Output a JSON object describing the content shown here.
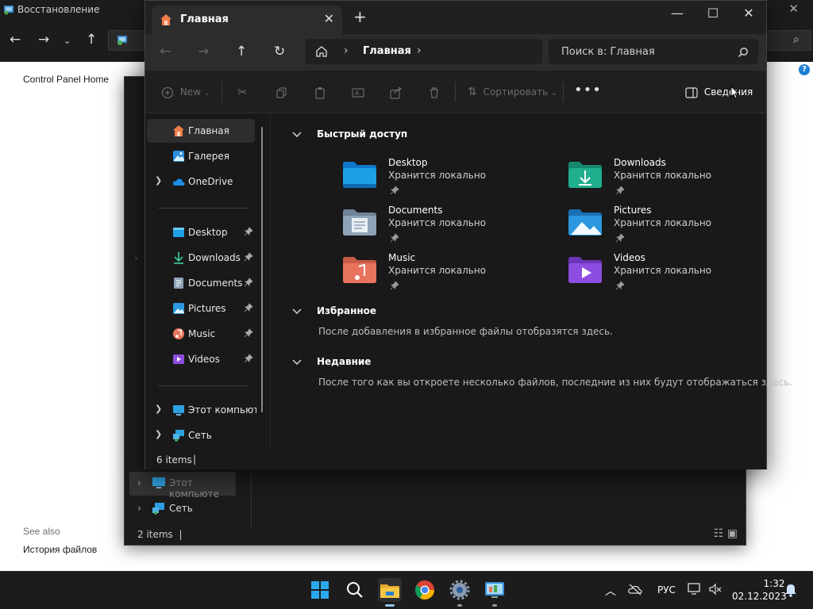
{
  "background_window": {
    "title": "Восстановление",
    "sidebar_link": "Control Panel Home",
    "see_also_label": "See also",
    "see_also_link": "История файлов"
  },
  "middle_window": {
    "items": [
      {
        "label": "Этот компьюте"
      },
      {
        "label": "Сеть"
      }
    ],
    "status": "2 items"
  },
  "explorer": {
    "tab_label": "Главная",
    "new_tab_symbol": "+",
    "address_label": "Главная",
    "search_placeholder": "Поиск в: Главная",
    "toolbar": {
      "new_label": "New",
      "sort_label": "Сортировать",
      "more_label": "•••",
      "details_label": "Сведения"
    },
    "sidebar": [
      {
        "label": "Главная",
        "icon": "home-icon"
      },
      {
        "label": "Галерея",
        "icon": "gallery-icon"
      },
      {
        "label": "OneDrive",
        "icon": "onedrive-icon"
      },
      {
        "label": "Desktop",
        "icon": "desktop-folder-icon"
      },
      {
        "label": "Downloads",
        "icon": "downloads-folder-icon"
      },
      {
        "label": "Documents",
        "icon": "documents-folder-icon"
      },
      {
        "label": "Pictures",
        "icon": "pictures-folder-icon"
      },
      {
        "label": "Music",
        "icon": "music-folder-icon"
      },
      {
        "label": "Videos",
        "icon": "videos-folder-icon"
      },
      {
        "label": "Этот компьюте",
        "icon": "this-pc-icon"
      },
      {
        "label": "Сеть",
        "icon": "network-icon"
      }
    ],
    "quick_access": {
      "heading": "Быстрый доступ",
      "items": [
        {
          "name": "Desktop",
          "status": "Хранится локально",
          "color": "#1ea0e6"
        },
        {
          "name": "Downloads",
          "status": "Хранится локально",
          "color": "#1fae8e"
        },
        {
          "name": "Documents",
          "status": "Хранится локально",
          "color": "#8fa3b8"
        },
        {
          "name": "Pictures",
          "status": "Хранится локально",
          "color": "#2b98e0"
        },
        {
          "name": "Music",
          "status": "Хранится локально",
          "color": "#e9745e"
        },
        {
          "name": "Videos",
          "status": "Хранится локально",
          "color": "#8c4de0"
        }
      ]
    },
    "favorites": {
      "heading": "Избранное",
      "message": "После добавления в избранное файлы отобразятся здесь."
    },
    "recent": {
      "heading": "Недавние",
      "message": "После того как вы откроете несколько файлов, последние из них будут отображаться здесь."
    },
    "status": "6 items"
  },
  "taskbar": {
    "language": "РУС",
    "time": "1:32",
    "date": "02.12.2023"
  }
}
